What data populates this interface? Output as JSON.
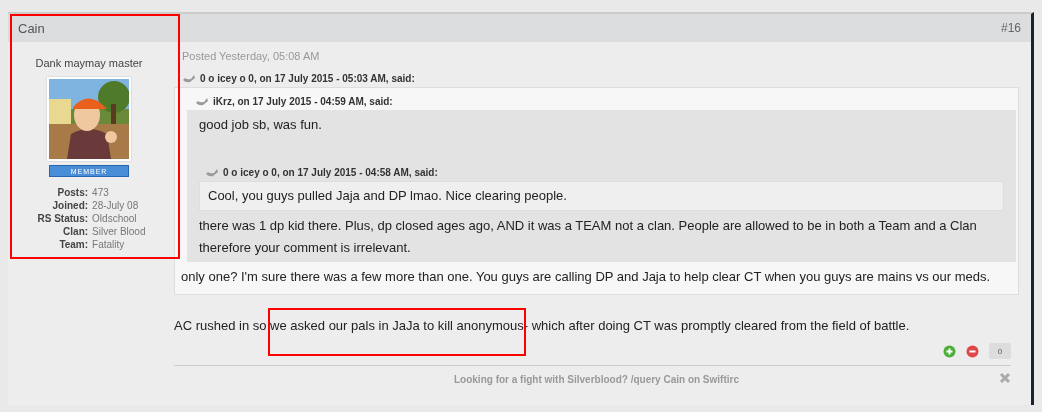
{
  "post": {
    "author": "Cain",
    "number": "#16",
    "posted": "Posted Yesterday, 05:08 AM",
    "quote": {
      "citation": "0 o icey o 0, on 17 July 2015 - 05:03 AM, said:",
      "content": [
        {
          "kind": "quote",
          "citation": "iKrz, on 17 July 2015 - 04:59 AM, said:",
          "content": [
            {
              "kind": "text",
              "text": "good job sb, was fun."
            },
            {
              "kind": "quote",
              "citation": "0 o icey o 0, on 17 July 2015 - 04:58 AM, said:",
              "content": [
                {
                  "kind": "text",
                  "text": "Cool, you guys pulled Jaja and DP lmao. Nice clearing people."
                }
              ]
            },
            {
              "kind": "text",
              "text": "there was 1 dp kid there. Plus, dp closed ages ago, AND it was a TEAM not a clan. People are allowed to be in both a Team and a Clan therefore your comment is irrelevant."
            }
          ]
        },
        {
          "kind": "text",
          "text": "only one? I'm sure there was a few more than one. You guys are calling DP and Jaja to help clear CT when you guys are mains vs our meds."
        }
      ]
    },
    "body": "AC rushed in so we asked our pals in JaJa to kill anonymous- which after doing CT was promptly cleared from the field of battle.",
    "reputation": "0",
    "signature": "Looking for a fight with Silverblood? /query Cain on Swiftirc"
  },
  "profile": {
    "title": "Dank maymay master",
    "rank": "MEMBER",
    "stats": [
      {
        "label": "Posts:",
        "value": "473"
      },
      {
        "label": "Joined:",
        "value": "28-July 08"
      },
      {
        "label": "RS Status:",
        "value": "Oldschool"
      },
      {
        "label": "Clan:",
        "value": "Silver Blood"
      },
      {
        "label": "Team:",
        "value": "Fatality"
      }
    ]
  }
}
